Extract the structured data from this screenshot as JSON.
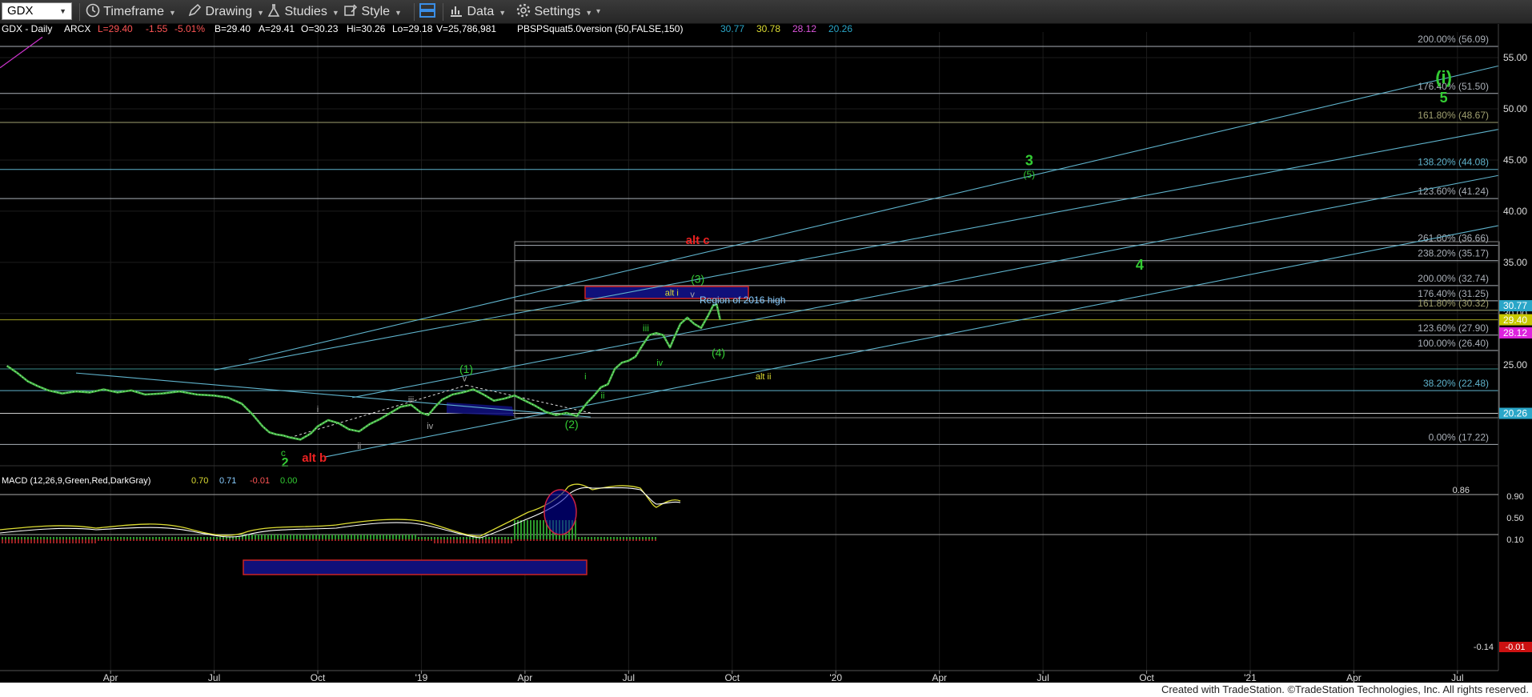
{
  "toolbar": {
    "symbol": "GDX",
    "timeframe": "Timeframe",
    "drawing": "Drawing",
    "studies": "Studies",
    "style": "Style",
    "data": "Data",
    "settings": "Settings"
  },
  "header": {
    "title": "GDX - Daily",
    "exchange": "ARCX",
    "last": "L=29.40",
    "change": "-1.55",
    "pct": "-5.01%",
    "bid": "B=29.40",
    "ask": "A=29.41",
    "open": "O=30.23",
    "high": "Hi=30.26",
    "low": "Lo=29.18",
    "volume": "V=25,786,981",
    "study": "PBSPSquat5.0version (50,FALSE,150)",
    "study_values": [
      "30.77",
      "30.78",
      "28.12",
      "20.26"
    ]
  },
  "colors": {
    "bg": "#000000",
    "grid": "#1c1c1c",
    "fib": "#aab0b8",
    "channel": "#5fb3cc",
    "green": "#33cc33",
    "red": "#ee2222",
    "yellow": "#dddd33",
    "blue_box": "#10107a"
  },
  "chart_data": {
    "type": "line",
    "ylim": [
      15.3,
      57.5
    ],
    "y_ticks": [
      25,
      30,
      35,
      40,
      45,
      50,
      55
    ],
    "x_ticks": [
      {
        "label": "Apr",
        "m": 3.0
      },
      {
        "label": "Jul",
        "m": 6.0
      },
      {
        "label": "Oct",
        "m": 9.0
      },
      {
        "label": "'19",
        "m": 12.0
      },
      {
        "label": "Apr",
        "m": 15.0
      },
      {
        "label": "Jul",
        "m": 18.0
      },
      {
        "label": "Oct",
        "m": 21.0
      },
      {
        "label": "'20",
        "m": 24.0
      },
      {
        "label": "Apr",
        "m": 27.0
      },
      {
        "label": "Jul",
        "m": 30.0
      },
      {
        "label": "Oct",
        "m": 33.0
      },
      {
        "label": "'21",
        "m": 36.0
      },
      {
        "label": "Apr",
        "m": 39.0
      },
      {
        "label": "Jul",
        "m": 42.0
      }
    ],
    "price": [
      [
        0.0,
        24.9
      ],
      [
        0.3,
        24.2
      ],
      [
        0.6,
        23.4
      ],
      [
        0.9,
        22.9
      ],
      [
        1.2,
        22.5
      ],
      [
        1.6,
        22.2
      ],
      [
        2.0,
        22.4
      ],
      [
        2.4,
        22.3
      ],
      [
        2.8,
        22.6
      ],
      [
        3.2,
        22.3
      ],
      [
        3.6,
        22.5
      ],
      [
        4.0,
        22.1
      ],
      [
        4.5,
        22.2
      ],
      [
        5.0,
        22.4
      ],
      [
        5.5,
        22.1
      ],
      [
        6.0,
        22.0
      ],
      [
        6.4,
        21.8
      ],
      [
        6.8,
        21.2
      ],
      [
        7.1,
        20.2
      ],
      [
        7.4,
        19.0
      ],
      [
        7.6,
        18.4
      ],
      [
        7.8,
        18.2
      ],
      [
        8.0,
        18.1
      ],
      [
        8.2,
        17.9
      ],
      [
        8.5,
        17.7
      ],
      [
        8.8,
        18.3
      ],
      [
        9.0,
        19.0
      ],
      [
        9.3,
        19.6
      ],
      [
        9.6,
        19.3
      ],
      [
        9.9,
        18.7
      ],
      [
        10.2,
        18.5
      ],
      [
        10.5,
        19.2
      ],
      [
        10.8,
        19.7
      ],
      [
        11.1,
        20.3
      ],
      [
        11.4,
        20.9
      ],
      [
        11.7,
        21.1
      ],
      [
        12.0,
        20.3
      ],
      [
        12.2,
        20.1
      ],
      [
        12.4,
        20.9
      ],
      [
        12.6,
        21.6
      ],
      [
        12.9,
        22.1
      ],
      [
        13.2,
        22.3
      ],
      [
        13.5,
        22.6
      ],
      [
        13.8,
        22.1
      ],
      [
        14.1,
        21.5
      ],
      [
        14.4,
        21.7
      ],
      [
        14.7,
        22.0
      ],
      [
        15.0,
        21.5
      ],
      [
        15.3,
        21.0
      ],
      [
        15.6,
        20.4
      ],
      [
        15.9,
        20.1
      ],
      [
        16.2,
        20.3
      ],
      [
        16.5,
        20.0
      ],
      [
        16.8,
        21.3
      ],
      [
        17.0,
        22.0
      ],
      [
        17.2,
        22.8
      ],
      [
        17.4,
        23.1
      ],
      [
        17.6,
        24.6
      ],
      [
        17.8,
        25.2
      ],
      [
        18.0,
        25.4
      ],
      [
        18.2,
        25.8
      ],
      [
        18.4,
        26.9
      ],
      [
        18.6,
        27.9
      ],
      [
        18.8,
        28.1
      ],
      [
        19.0,
        27.9
      ],
      [
        19.1,
        27.3
      ],
      [
        19.2,
        26.7
      ],
      [
        19.35,
        27.9
      ],
      [
        19.5,
        29.0
      ],
      [
        19.7,
        29.6
      ],
      [
        19.9,
        29.0
      ],
      [
        20.1,
        28.6
      ],
      [
        20.3,
        29.8
      ],
      [
        20.45,
        30.8
      ],
      [
        20.55,
        30.9
      ],
      [
        20.65,
        29.4
      ]
    ],
    "fib_lines": [
      {
        "label": "200.00% (56.09)",
        "y": 56.09
      },
      {
        "label": "176.40% (51.50)",
        "y": 51.5
      },
      {
        "label": "161.80% (48.67)",
        "y": 48.67,
        "color": "#a0a070"
      },
      {
        "label": "138.20% (44.08)",
        "y": 44.08,
        "color": "#5fb3cc"
      },
      {
        "label": "123.60% (41.24)",
        "y": 41.24
      },
      {
        "label": "261.80% (36.66)",
        "y": 36.66
      },
      {
        "label": "238.20% (35.17)",
        "y": 35.17
      },
      {
        "label": "200.00% (32.74)",
        "y": 32.74
      },
      {
        "label": "176.40% (31.25)",
        "y": 31.25
      },
      {
        "label": "161.80% (30.32)",
        "y": 30.32,
        "color": "#a0a070"
      },
      {
        "label": "123.60% (27.90)",
        "y": 27.9
      },
      {
        "label": "100.00% (26.40)",
        "y": 26.4
      },
      {
        "label": "38.20% (22.48)",
        "y": 22.48,
        "color": "#5fb3cc"
      },
      {
        "label": "0.00% (17.22)",
        "y": 17.22
      }
    ],
    "price_tags": [
      {
        "label": "30.77",
        "y": 30.77,
        "color": "#2aa6c8"
      },
      {
        "label": "29.40",
        "y": 29.4,
        "color": "#c8c800"
      },
      {
        "label": "28.12",
        "y": 28.12,
        "color": "#dd22dd"
      },
      {
        "label": "20.26",
        "y": 20.26,
        "color": "#2aa6c8"
      }
    ],
    "wave_labels": [
      {
        "text": "(i)",
        "m": 41.6,
        "y": 53.1,
        "color": "#33cc33",
        "size": 22
      },
      {
        "text": "5",
        "m": 41.6,
        "y": 51.1,
        "color": "#33cc33",
        "size": 18
      },
      {
        "text": "3",
        "m": 29.6,
        "y": 45.0,
        "color": "#33cc33",
        "size": 18
      },
      {
        "text": "(5)",
        "m": 29.6,
        "y": 43.6,
        "color": "#33cc33",
        "size": 12
      },
      {
        "text": "4",
        "m": 32.8,
        "y": 34.8,
        "color": "#33cc33",
        "size": 18
      },
      {
        "text": "alt c",
        "m": 20.0,
        "y": 37.2,
        "color": "#ee2222",
        "size": 15
      },
      {
        "text": "(3)",
        "m": 20.0,
        "y": 33.4,
        "color": "#33cc33",
        "size": 14
      },
      {
        "text": "alt i",
        "m": 19.25,
        "y": 32.05,
        "color": "#dddd33",
        "size": 11
      },
      {
        "text": "v",
        "m": 19.85,
        "y": 31.9,
        "color": "#aaaaaa",
        "size": 11
      },
      {
        "text": "iii",
        "m": 18.5,
        "y": 28.6,
        "color": "#33cc33",
        "size": 12
      },
      {
        "text": "iv",
        "m": 18.9,
        "y": 25.2,
        "color": "#33cc33",
        "size": 11
      },
      {
        "text": "(4)",
        "m": 20.6,
        "y": 26.2,
        "color": "#33cc33",
        "size": 14
      },
      {
        "text": "alt ii",
        "m": 21.9,
        "y": 23.9,
        "color": "#dddd33",
        "size": 11
      },
      {
        "text": "i",
        "m": 16.75,
        "y": 23.9,
        "color": "#33cc33",
        "size": 11
      },
      {
        "text": "ii",
        "m": 17.25,
        "y": 22.0,
        "color": "#33cc33",
        "size": 11
      },
      {
        "text": "(2)",
        "m": 16.35,
        "y": 19.2,
        "color": "#33cc33",
        "size": 14
      },
      {
        "text": "(1)",
        "m": 13.3,
        "y": 24.6,
        "color": "#33cc33",
        "size": 14
      },
      {
        "text": "v",
        "m": 13.25,
        "y": 23.7,
        "color": "#aaaaaa",
        "size": 11
      },
      {
        "text": "iii",
        "m": 11.7,
        "y": 21.6,
        "color": "#aaaaaa",
        "size": 11
      },
      {
        "text": "iv",
        "m": 12.25,
        "y": 19.05,
        "color": "#aaaaaa",
        "size": 11
      },
      {
        "text": "ii",
        "m": 10.2,
        "y": 17.1,
        "color": "#aaaaaa",
        "size": 11
      },
      {
        "text": "i",
        "m": 9.0,
        "y": 20.7,
        "color": "#aaaaaa",
        "size": 11
      },
      {
        "text": "c",
        "m": 8.0,
        "y": 16.4,
        "color": "#33cc33",
        "size": 12
      },
      {
        "text": "2",
        "m": 8.05,
        "y": 15.5,
        "color": "#33cc33",
        "size": 16
      },
      {
        "text": "alt b",
        "m": 8.9,
        "y": 15.95,
        "color": "#ee2222",
        "size": 15
      },
      {
        "text": "Region of 2016 high",
        "m": 21.3,
        "y": 31.35,
        "color": "#88ccff",
        "size": 12
      }
    ],
    "macd": {
      "label": "MACD (12,26,9,Green,Red,DarkGray)",
      "values": [
        "0.70",
        "0.71",
        "-0.01",
        "0.00"
      ],
      "y_ticks": [
        0.86,
        0.9,
        0.5,
        0.1,
        -0.14
      ],
      "tags": [
        "-0.14",
        "-0.01"
      ]
    }
  },
  "footer": {
    "credit": "Created with TradeStation. ©TradeStation Technologies, Inc. All rights reserved."
  }
}
